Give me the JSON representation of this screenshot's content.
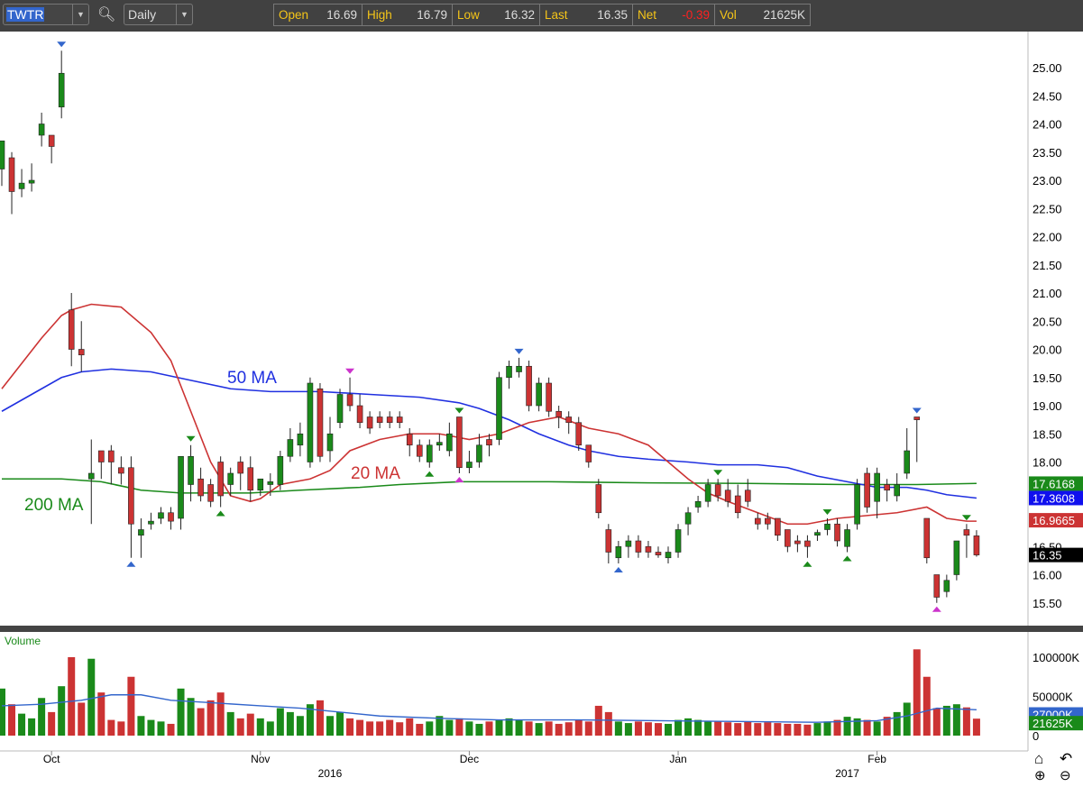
{
  "toolbar": {
    "symbol": "TWTR",
    "interval": "Daily",
    "quote": [
      {
        "label": "Open",
        "value": "16.69",
        "color": "#dddddd"
      },
      {
        "label": "High",
        "value": "16.79",
        "color": "#dddddd"
      },
      {
        "label": "Low",
        "value": "16.32",
        "color": "#dddddd"
      },
      {
        "label": "Last",
        "value": "16.35",
        "color": "#dddddd"
      },
      {
        "label": "Net",
        "value": "-0.39",
        "color": "#ff2020"
      },
      {
        "label": "Vol",
        "value": "21625K",
        "color": "#dddddd"
      }
    ]
  },
  "colors": {
    "up": "#1a8a1a",
    "down": "#cc3333",
    "ma20": "#cc3333",
    "ma50": "#2030e0",
    "ma200": "#1a8a1a",
    "volma": "#3366cc"
  },
  "chart_data": {
    "type": "candlestick",
    "symbol": "TWTR",
    "ylim": [
      15.2,
      25.6
    ],
    "y_ticks": [
      "25.00",
      "24.50",
      "24.00",
      "23.50",
      "23.00",
      "22.50",
      "22.00",
      "21.50",
      "21.00",
      "20.50",
      "20.00",
      "19.50",
      "19.00",
      "18.50",
      "18.00",
      "17.50",
      "17.00",
      "16.50",
      "16.00",
      "15.50"
    ],
    "x_ticks": [
      {
        "label": "Oct",
        "i": 5
      },
      {
        "label": "Nov",
        "i": 26
      },
      {
        "label": "Dec",
        "i": 47
      },
      {
        "label": "Jan",
        "i": 68
      },
      {
        "label": "Feb",
        "i": 88
      }
    ],
    "year_ticks": [
      {
        "label": "2016",
        "i": 33
      },
      {
        "label": "2017",
        "i": 85
      }
    ],
    "ohlc": [
      [
        23.2,
        23.7,
        22.9,
        23.7
      ],
      [
        23.4,
        23.5,
        22.4,
        22.8
      ],
      [
        22.85,
        23.2,
        22.7,
        22.95
      ],
      [
        22.95,
        23.3,
        22.8,
        23.0
      ],
      [
        23.8,
        24.2,
        23.6,
        24.0
      ],
      [
        23.8,
        23.8,
        23.3,
        23.6
      ],
      [
        24.3,
        25.3,
        24.1,
        24.9
      ],
      [
        20.7,
        21.0,
        19.7,
        20.0
      ],
      [
        20.0,
        20.5,
        19.6,
        19.9
      ],
      [
        17.7,
        18.4,
        16.9,
        17.8
      ],
      [
        18.2,
        18.2,
        17.7,
        18.0
      ],
      [
        18.2,
        18.3,
        17.6,
        18.0
      ],
      [
        17.9,
        18.1,
        17.6,
        17.8
      ],
      [
        17.9,
        18.1,
        16.3,
        16.9
      ],
      [
        16.7,
        17.0,
        16.3,
        16.8
      ],
      [
        16.9,
        17.1,
        16.8,
        16.95
      ],
      [
        17.0,
        17.2,
        16.9,
        17.1
      ],
      [
        17.1,
        17.2,
        16.8,
        16.95
      ],
      [
        17.0,
        18.1,
        16.8,
        18.1
      ],
      [
        17.6,
        18.3,
        17.3,
        18.1
      ],
      [
        17.7,
        17.9,
        17.3,
        17.4
      ],
      [
        17.6,
        17.7,
        17.2,
        17.3
      ],
      [
        18.0,
        18.1,
        17.2,
        17.4
      ],
      [
        17.6,
        17.9,
        17.4,
        17.8
      ],
      [
        18.0,
        18.1,
        17.5,
        17.8
      ],
      [
        17.9,
        18.1,
        17.3,
        17.5
      ],
      [
        17.5,
        17.7,
        17.4,
        17.7
      ],
      [
        17.6,
        17.8,
        17.4,
        17.65
      ],
      [
        17.6,
        18.2,
        17.5,
        18.1
      ],
      [
        18.1,
        18.6,
        18.0,
        18.4
      ],
      [
        18.3,
        18.7,
        18.1,
        18.5
      ],
      [
        18.0,
        19.5,
        17.9,
        19.4
      ],
      [
        19.3,
        19.4,
        18.0,
        18.1
      ],
      [
        18.2,
        18.8,
        18.0,
        18.5
      ],
      [
        18.7,
        19.3,
        18.6,
        19.2
      ],
      [
        19.2,
        19.5,
        18.9,
        19.0
      ],
      [
        19.0,
        19.2,
        18.6,
        18.7
      ],
      [
        18.8,
        18.9,
        18.5,
        18.6
      ],
      [
        18.8,
        18.9,
        18.6,
        18.7
      ],
      [
        18.8,
        18.9,
        18.6,
        18.7
      ],
      [
        18.8,
        18.9,
        18.6,
        18.7
      ],
      [
        18.5,
        18.6,
        18.1,
        18.3
      ],
      [
        18.3,
        18.4,
        18.0,
        18.1
      ],
      [
        18.0,
        18.4,
        17.9,
        18.3
      ],
      [
        18.3,
        18.5,
        18.2,
        18.35
      ],
      [
        18.2,
        18.7,
        18.1,
        18.5
      ],
      [
        18.8,
        18.8,
        17.8,
        17.9
      ],
      [
        17.9,
        18.2,
        17.8,
        18.0
      ],
      [
        18.0,
        18.5,
        17.9,
        18.3
      ],
      [
        18.4,
        18.5,
        18.1,
        18.3
      ],
      [
        18.4,
        19.6,
        18.3,
        19.5
      ],
      [
        19.5,
        19.8,
        19.3,
        19.7
      ],
      [
        19.6,
        19.85,
        19.5,
        19.7
      ],
      [
        19.7,
        19.8,
        18.9,
        19.0
      ],
      [
        19.0,
        19.5,
        18.9,
        19.4
      ],
      [
        19.4,
        19.5,
        18.8,
        18.9
      ],
      [
        18.9,
        19.0,
        18.6,
        18.8
      ],
      [
        18.8,
        18.9,
        18.5,
        18.7
      ],
      [
        18.7,
        18.8,
        18.2,
        18.3
      ],
      [
        18.3,
        18.3,
        17.9,
        18.0
      ],
      [
        17.6,
        17.7,
        17.0,
        17.1
      ],
      [
        16.8,
        16.9,
        16.2,
        16.4
      ],
      [
        16.3,
        16.6,
        16.2,
        16.5
      ],
      [
        16.5,
        16.7,
        16.3,
        16.6
      ],
      [
        16.6,
        16.7,
        16.3,
        16.4
      ],
      [
        16.5,
        16.6,
        16.3,
        16.4
      ],
      [
        16.4,
        16.5,
        16.3,
        16.35
      ],
      [
        16.3,
        16.5,
        16.2,
        16.4
      ],
      [
        16.4,
        16.9,
        16.3,
        16.8
      ],
      [
        16.9,
        17.2,
        16.7,
        17.1
      ],
      [
        17.2,
        17.4,
        17.1,
        17.3
      ],
      [
        17.3,
        17.7,
        17.2,
        17.6
      ],
      [
        17.6,
        17.7,
        17.3,
        17.4
      ],
      [
        17.5,
        17.7,
        17.2,
        17.3
      ],
      [
        17.4,
        17.6,
        17.0,
        17.1
      ],
      [
        17.5,
        17.7,
        17.2,
        17.3
      ],
      [
        17.0,
        17.1,
        16.8,
        16.9
      ],
      [
        17.0,
        17.1,
        16.8,
        16.9
      ],
      [
        17.0,
        17.0,
        16.6,
        16.7
      ],
      [
        16.8,
        16.8,
        16.4,
        16.5
      ],
      [
        16.6,
        16.7,
        16.4,
        16.55
      ],
      [
        16.6,
        16.7,
        16.3,
        16.5
      ],
      [
        16.7,
        16.8,
        16.6,
        16.75
      ],
      [
        16.8,
        17.0,
        16.7,
        16.9
      ],
      [
        16.9,
        17.0,
        16.5,
        16.6
      ],
      [
        16.5,
        16.9,
        16.4,
        16.8
      ],
      [
        16.9,
        17.7,
        16.8,
        17.6
      ],
      [
        17.8,
        17.9,
        17.1,
        17.2
      ],
      [
        17.3,
        17.9,
        17.0,
        17.8
      ],
      [
        17.6,
        17.7,
        17.3,
        17.5
      ],
      [
        17.4,
        17.8,
        17.3,
        17.6
      ],
      [
        17.8,
        18.6,
        17.7,
        18.2
      ],
      [
        18.8,
        18.8,
        18.0,
        18.75
      ],
      [
        17.0,
        17.0,
        16.2,
        16.3
      ],
      [
        16.0,
        16.0,
        15.5,
        15.6
      ],
      [
        15.7,
        16.0,
        15.6,
        15.9
      ],
      [
        16.0,
        16.6,
        15.9,
        16.6
      ],
      [
        16.8,
        16.9,
        16.3,
        16.7
      ],
      [
        16.69,
        16.79,
        16.32,
        16.35
      ]
    ],
    "volume": [
      60000,
      40000,
      28000,
      22000,
      48000,
      30000,
      63000,
      100000,
      42000,
      98000,
      55000,
      20000,
      18000,
      75000,
      25000,
      20000,
      18000,
      15000,
      60000,
      48000,
      35000,
      45000,
      55000,
      30000,
      22000,
      28000,
      22000,
      18000,
      35000,
      30000,
      25000,
      40000,
      45000,
      25000,
      30000,
      22000,
      20000,
      18000,
      18000,
      20000,
      17000,
      22000,
      15000,
      18000,
      25000,
      20000,
      22000,
      18000,
      15000,
      18000,
      20000,
      22000,
      20000,
      18000,
      16000,
      18000,
      15000,
      17000,
      20000,
      18000,
      38000,
      30000,
      18000,
      16000,
      18000,
      17000,
      16000,
      15000,
      20000,
      22000,
      20000,
      19000,
      18000,
      17000,
      16000,
      18000,
      16000,
      17000,
      16000,
      15000,
      15000,
      14000,
      16000,
      18000,
      20000,
      24000,
      22000,
      20000,
      18000,
      24000,
      30000,
      42000,
      110000,
      75000,
      35000,
      38000,
      40000,
      36000,
      21625
    ],
    "ma20": [
      [
        0,
        19.3
      ],
      [
        4,
        20.2
      ],
      [
        6,
        20.6
      ],
      [
        7,
        20.7
      ],
      [
        9,
        20.8
      ],
      [
        12,
        20.75
      ],
      [
        15,
        20.3
      ],
      [
        17,
        19.8
      ],
      [
        19,
        18.9
      ],
      [
        21,
        18.0
      ],
      [
        23,
        17.4
      ],
      [
        25,
        17.3
      ],
      [
        26,
        17.35
      ],
      [
        28,
        17.6
      ],
      [
        31,
        17.7
      ],
      [
        33,
        17.85
      ],
      [
        35,
        18.2
      ],
      [
        38,
        18.4
      ],
      [
        41,
        18.5
      ],
      [
        44,
        18.5
      ],
      [
        47,
        18.4
      ],
      [
        50,
        18.5
      ],
      [
        53,
        18.7
      ],
      [
        56,
        18.8
      ],
      [
        59,
        18.6
      ],
      [
        62,
        18.5
      ],
      [
        65,
        18.3
      ],
      [
        67,
        18.0
      ],
      [
        69,
        17.7
      ],
      [
        71,
        17.45
      ],
      [
        73,
        17.3
      ],
      [
        76,
        17.1
      ],
      [
        79,
        16.9
      ],
      [
        81,
        16.9
      ],
      [
        84,
        17.0
      ],
      [
        87,
        17.05
      ],
      [
        90,
        17.1
      ],
      [
        93,
        17.2
      ],
      [
        95,
        17.0
      ],
      [
        97,
        16.95
      ],
      [
        98,
        16.95
      ]
    ],
    "ma50": [
      [
        0,
        18.9
      ],
      [
        3,
        19.2
      ],
      [
        6,
        19.5
      ],
      [
        8,
        19.6
      ],
      [
        11,
        19.65
      ],
      [
        15,
        19.6
      ],
      [
        19,
        19.45
      ],
      [
        23,
        19.3
      ],
      [
        27,
        19.25
      ],
      [
        32,
        19.25
      ],
      [
        37,
        19.2
      ],
      [
        42,
        19.15
      ],
      [
        46,
        19.05
      ],
      [
        48,
        18.95
      ],
      [
        51,
        18.75
      ],
      [
        54,
        18.5
      ],
      [
        57,
        18.3
      ],
      [
        59,
        18.2
      ],
      [
        62,
        18.1
      ],
      [
        65,
        18.05
      ],
      [
        69,
        18.0
      ],
      [
        72,
        17.95
      ],
      [
        76,
        17.95
      ],
      [
        79,
        17.9
      ],
      [
        82,
        17.75
      ],
      [
        85,
        17.65
      ],
      [
        88,
        17.55
      ],
      [
        91,
        17.55
      ],
      [
        93,
        17.5
      ],
      [
        95,
        17.42
      ],
      [
        98,
        17.36
      ]
    ],
    "ma200": [
      [
        0,
        17.7
      ],
      [
        6,
        17.7
      ],
      [
        10,
        17.65
      ],
      [
        14,
        17.5
      ],
      [
        18,
        17.45
      ],
      [
        25,
        17.45
      ],
      [
        30,
        17.5
      ],
      [
        36,
        17.55
      ],
      [
        40,
        17.6
      ],
      [
        46,
        17.65
      ],
      [
        55,
        17.65
      ],
      [
        65,
        17.63
      ],
      [
        75,
        17.62
      ],
      [
        85,
        17.6
      ],
      [
        92,
        17.6
      ],
      [
        98,
        17.62
      ]
    ],
    "volma": [
      [
        0,
        38000
      ],
      [
        4,
        40000
      ],
      [
        8,
        45000
      ],
      [
        11,
        52000
      ],
      [
        14,
        52000
      ],
      [
        17,
        45000
      ],
      [
        21,
        42000
      ],
      [
        26,
        38000
      ],
      [
        30,
        35000
      ],
      [
        34,
        30000
      ],
      [
        38,
        25000
      ],
      [
        44,
        22000
      ],
      [
        50,
        20000
      ],
      [
        58,
        20000
      ],
      [
        66,
        19000
      ],
      [
        74,
        18000
      ],
      [
        82,
        17000
      ],
      [
        88,
        19000
      ],
      [
        91,
        25000
      ],
      [
        94,
        35000
      ],
      [
        98,
        33000
      ]
    ],
    "markers": [
      {
        "i": 6,
        "dir": "down",
        "color": "#3366cc"
      },
      {
        "i": 13,
        "dir": "up",
        "color": "#3366cc"
      },
      {
        "i": 19,
        "dir": "down",
        "color": "#1a8a1a"
      },
      {
        "i": 22,
        "dir": "up",
        "color": "#1a8a1a"
      },
      {
        "i": 35,
        "dir": "down",
        "color": "#cc33cc"
      },
      {
        "i": 43,
        "dir": "up",
        "color": "#1a8a1a"
      },
      {
        "i": 46,
        "dir": "down",
        "color": "#1a8a1a"
      },
      {
        "i": 46,
        "dir": "up",
        "color": "#cc33cc"
      },
      {
        "i": 52,
        "dir": "down",
        "color": "#3366cc"
      },
      {
        "i": 62,
        "dir": "up",
        "color": "#3366cc"
      },
      {
        "i": 72,
        "dir": "down",
        "color": "#1a8a1a"
      },
      {
        "i": 81,
        "dir": "up",
        "color": "#1a8a1a"
      },
      {
        "i": 83,
        "dir": "down",
        "color": "#1a8a1a"
      },
      {
        "i": 85,
        "dir": "up",
        "color": "#1a8a1a"
      },
      {
        "i": 92,
        "dir": "down",
        "color": "#3366cc"
      },
      {
        "i": 94,
        "dir": "up",
        "color": "#cc33cc"
      },
      {
        "i": 97,
        "dir": "down",
        "color": "#1a8a1a"
      }
    ],
    "ma_labels": {
      "ma50": "50 MA",
      "ma20": "20 MA",
      "ma200": "200 MA"
    },
    "price_tags": [
      {
        "value": "17.6168",
        "color": "#1a8a1a"
      },
      {
        "value": "17.3608",
        "color": "#1010ee"
      },
      {
        "value": "16.9665",
        "color": "#cc3333"
      },
      {
        "value": "16.35",
        "color": "#000000"
      }
    ],
    "volume_panel": {
      "label": "Volume",
      "y_ticks": [
        "100000K",
        "50000K",
        "0"
      ],
      "tags": [
        {
          "value": "27000K",
          "color": "#3366cc"
        },
        {
          "value": "21625K",
          "color": "#1a8a1a"
        }
      ]
    }
  }
}
